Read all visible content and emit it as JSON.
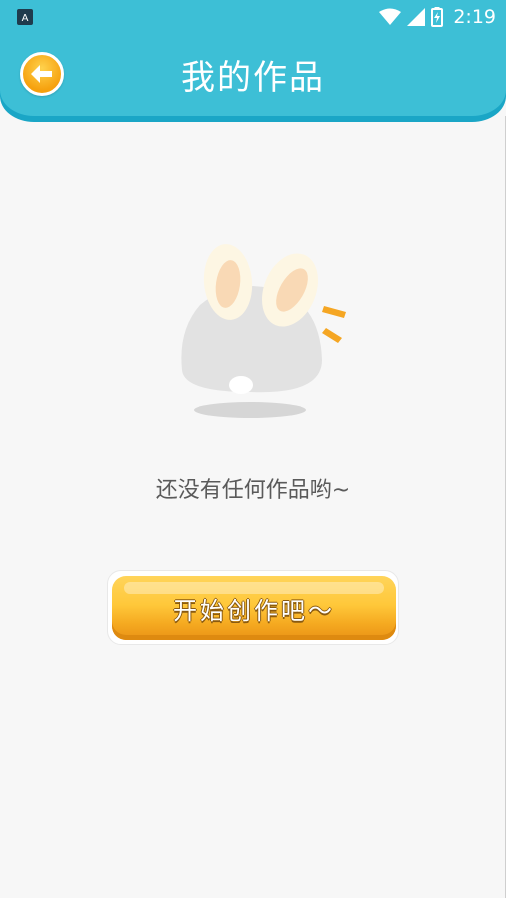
{
  "status_bar": {
    "time": "2:19",
    "icons": [
      "app-notification-icon",
      "wifi-icon",
      "cell-signal-icon",
      "battery-charging-icon"
    ]
  },
  "header": {
    "title": "我的作品",
    "back_icon": "back-arrow-icon"
  },
  "empty_state": {
    "illustration": "bunny-illustration",
    "message": "还没有任何作品哟~"
  },
  "actions": {
    "start_label": "开始创作吧～"
  },
  "colors": {
    "header": "#3dbfd6",
    "header_shadow": "#1aa6c6",
    "button": "#f5a920",
    "background": "#f7f7f7",
    "text": "#5a5a5a"
  }
}
